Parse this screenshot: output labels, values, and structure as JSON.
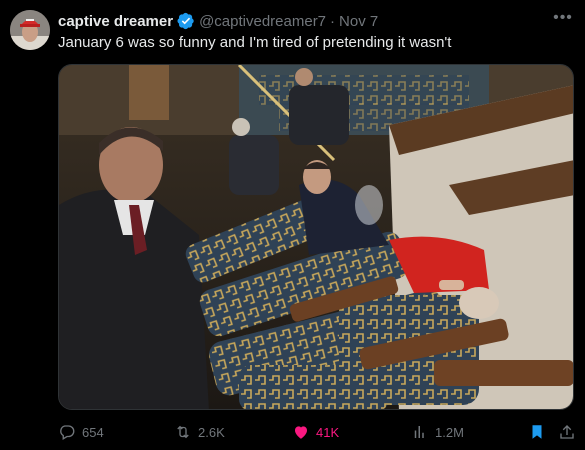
{
  "tweet": {
    "display_name": "captive dreamer",
    "handle": "@captivedreamer7",
    "separator": "·",
    "date": "Nov 7",
    "text": "January 6 was so funny and I'm tired of pretending it wasn't",
    "verified": true
  },
  "media": {
    "type": "photo",
    "icon": "photo-image"
  },
  "actions": {
    "replies": "654",
    "reposts": "2.6K",
    "likes": "41K",
    "views": "1.2M",
    "liked": true,
    "bookmarked": true
  },
  "colors": {
    "background": "#000000",
    "text": "#e7e9ea",
    "muted": "#71767b",
    "verified": "#1d9bf0",
    "like": "#f91880",
    "bookmark": "#1d9bf0"
  }
}
